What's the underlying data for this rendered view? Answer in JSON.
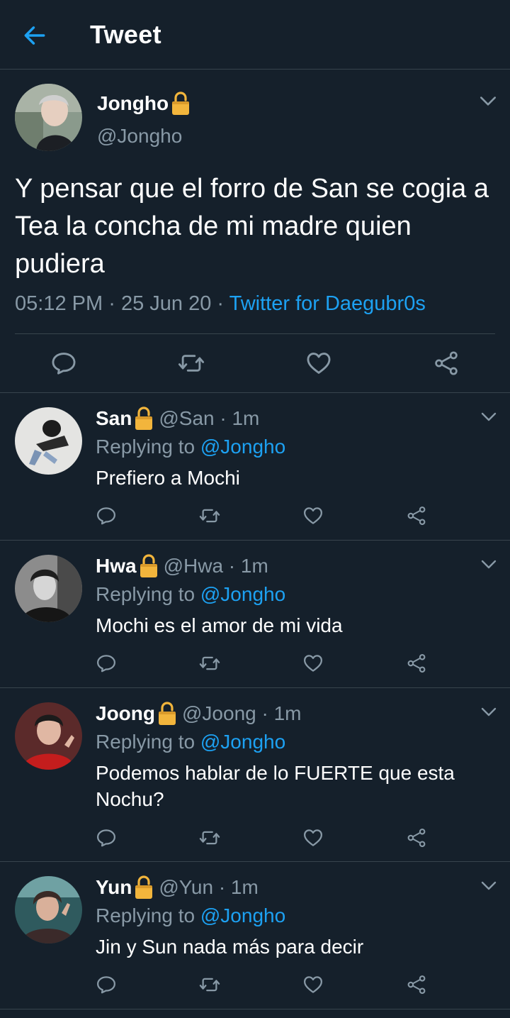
{
  "header": {
    "title": "Tweet"
  },
  "colors": {
    "background": "#15202b",
    "accent": "#1da1f2",
    "secondary_text": "#8899a6",
    "divider": "#38444d",
    "lock": "#f2b53c"
  },
  "main_tweet": {
    "name": "Jongho",
    "handle": "@Jongho",
    "text": "Y pensar que el forro de San se cogia a Tea la concha de mi madre quien pudiera",
    "time": "05:12 PM",
    "date": "25 Jun 20",
    "source": "Twitter for Daegubr0s",
    "separator": "·"
  },
  "replies": [
    {
      "name": "San",
      "meta": "@San · 1m",
      "replying_label": "Replying to",
      "mention": "@Jongho",
      "text": "Prefiero a Mochi"
    },
    {
      "name": "Hwa",
      "meta": "@Hwa · 1m",
      "replying_label": "Replying to",
      "mention": "@Jongho",
      "text": "Mochi es el amor de mi vida"
    },
    {
      "name": "Joong",
      "meta": "@Joong · 1m",
      "replying_label": "Replying to",
      "mention": "@Jongho",
      "text": "Podemos hablar de lo FUERTE que esta Nochu?"
    },
    {
      "name": "Yun",
      "meta": "@Yun · 1m",
      "replying_label": "Replying to",
      "mention": "@Jongho",
      "text": "Jin y Sun nada más para decir"
    }
  ],
  "icons": [
    "back-arrow-icon",
    "lock-icon",
    "chevron-down-icon",
    "reply-icon",
    "retweet-icon",
    "like-icon",
    "share-icon"
  ]
}
